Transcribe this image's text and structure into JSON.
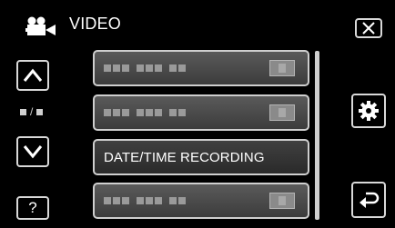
{
  "header": {
    "icon": "video-camera-icon",
    "title": "VIDEO"
  },
  "nav": {
    "up_icon": "chevron-up-icon",
    "down_icon": "chevron-down-icon",
    "page_indicator": "■/■",
    "help_label": "?"
  },
  "window": {
    "close_icon": "close-icon"
  },
  "side": {
    "settings_icon": "gear-icon",
    "back_icon": "return-icon"
  },
  "menu": {
    "items": [
      {
        "label": "",
        "obscured": true
      },
      {
        "label": "",
        "obscured": true
      },
      {
        "label": "DATE/TIME RECORDING",
        "obscured": false
      },
      {
        "label": "",
        "obscured": true
      }
    ]
  },
  "colors": {
    "background": "#000000",
    "item_fill": "#4a4a4a",
    "border": "#cfcfcf"
  }
}
